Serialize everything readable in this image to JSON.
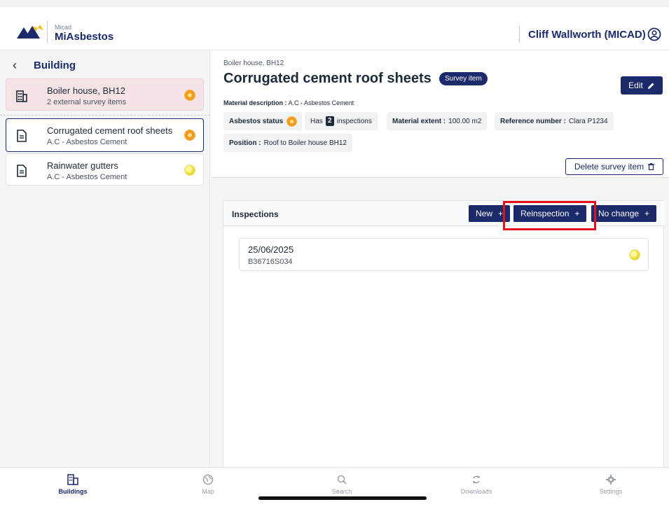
{
  "app": {
    "brand_small": "Micad",
    "brand": "MiAsbestos",
    "user": "Cliff Wallworth (MICAD)",
    "accent_color": "#1b2a6b"
  },
  "sidebar": {
    "back_label": "Building",
    "parent": {
      "title": "Boiler house, BH12",
      "subtitle": "2 external survey items",
      "status": "orange",
      "icon": "building-icon"
    },
    "items": [
      {
        "title": "Corrugated cement roof sheets",
        "subtitle": "A.C - Asbestos Cement",
        "status": "orange",
        "selected": true,
        "icon": "document-icon"
      },
      {
        "title": "Rainwater gutters",
        "subtitle": "A.C - Asbestos Cement",
        "status": "yellow",
        "selected": false,
        "icon": "document-icon"
      }
    ]
  },
  "detail": {
    "breadcrumb": "Boiler house, BH12",
    "title": "Corrugated cement roof sheets",
    "badge": "Survey item",
    "edit_label": "Edit",
    "material_label": "Material description :",
    "material_value": "A.C - Asbestos Cement",
    "asbestos_status_label": "Asbestos status",
    "has_label": "Has",
    "inspection_count": "2",
    "inspections_label": "inspections",
    "extent_label": "Material extent :",
    "extent_value": "100.00 m2",
    "reference_label": "Reference number :",
    "reference_value": "Clara P1234",
    "position_label": "Position :",
    "position_value": "Roof to Boiler house BH12",
    "delete_label": "Delete survey item"
  },
  "inspections": {
    "title": "Inspections",
    "new_label": "New",
    "reinspection_label": "Reinspection",
    "nochange_label": "No change",
    "items": [
      {
        "date": "25/06/2025",
        "code": "B36716S034",
        "status": "yellow"
      }
    ]
  },
  "tabs": [
    {
      "label": "Buildings",
      "icon": "buildings-icon",
      "active": true
    },
    {
      "label": "Map",
      "icon": "map-icon",
      "active": false
    },
    {
      "label": "Search",
      "icon": "search-icon",
      "active": false
    },
    {
      "label": "Downloads",
      "icon": "sync-icon",
      "active": false
    },
    {
      "label": "Settings",
      "icon": "gear-icon",
      "active": false
    }
  ]
}
